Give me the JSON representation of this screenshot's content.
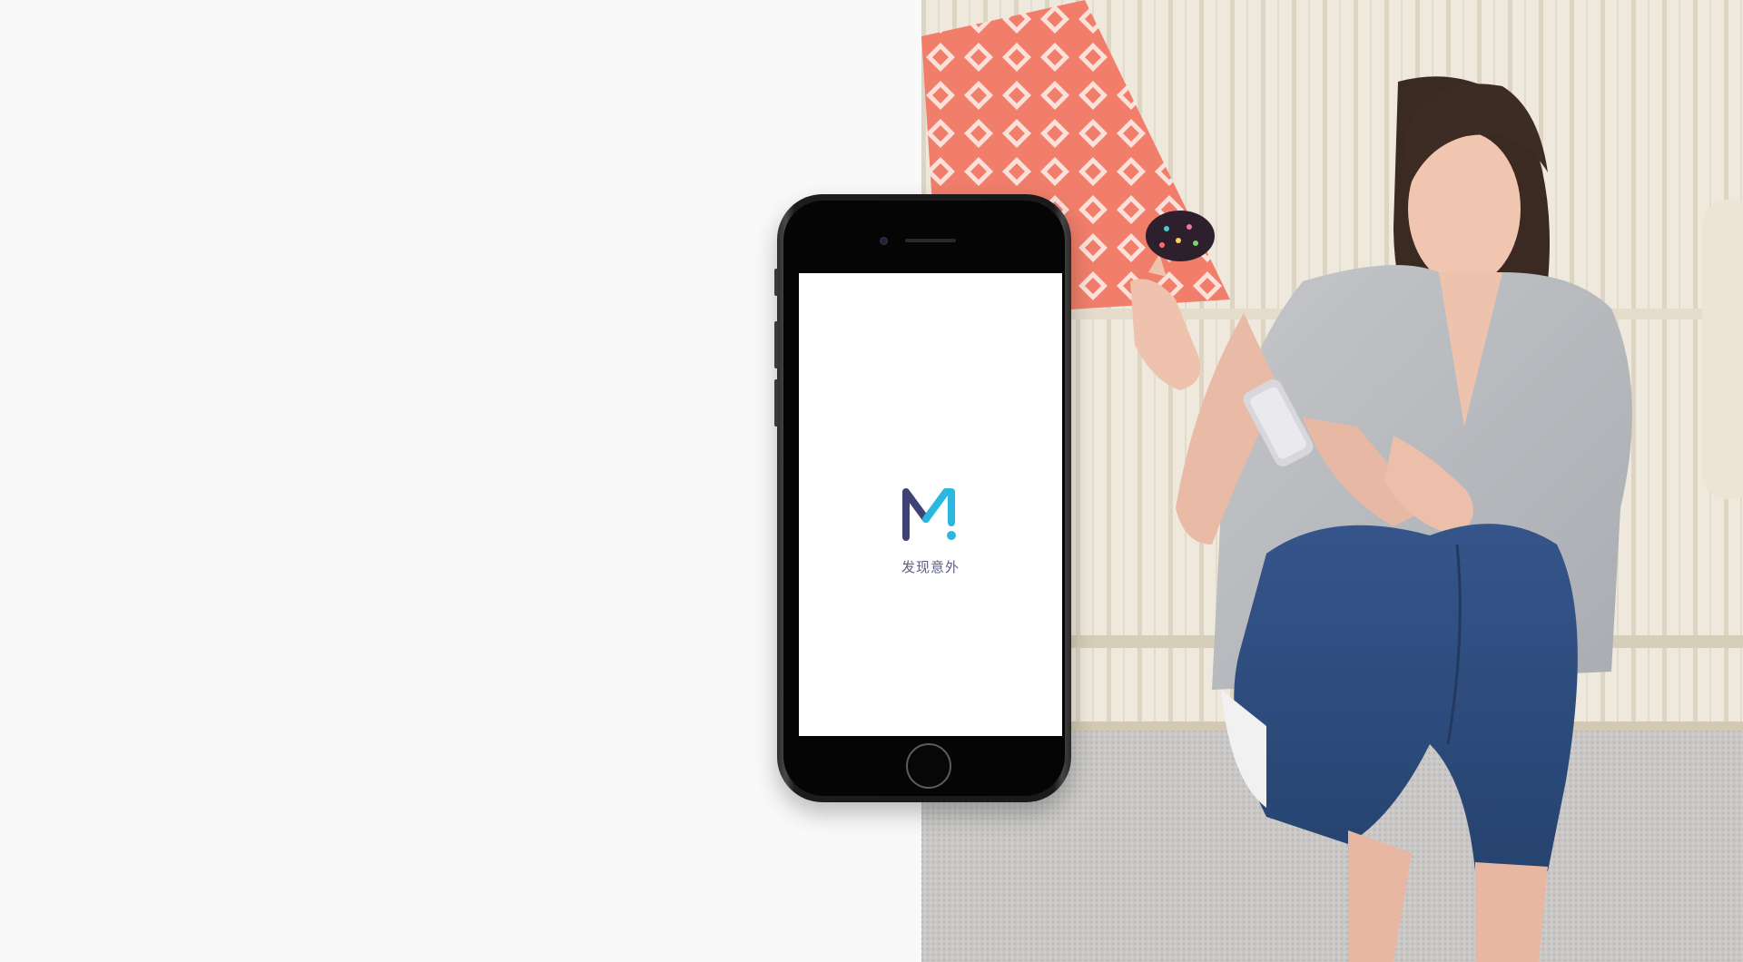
{
  "app": {
    "tagline": "发现意外",
    "logo_letter": "M",
    "logo_accent": "!"
  },
  "icons": {
    "logo": "m-exclamation-logo-icon",
    "home": "home-button-icon",
    "camera": "front-camera-icon"
  },
  "colors": {
    "background_left": "#f9f9f9",
    "logo_dark": "#3f4274",
    "logo_light": "#2ab8df",
    "tagline": "#5b5f82",
    "phone_body": "#1a1a1a",
    "screen": "#ffffff"
  }
}
